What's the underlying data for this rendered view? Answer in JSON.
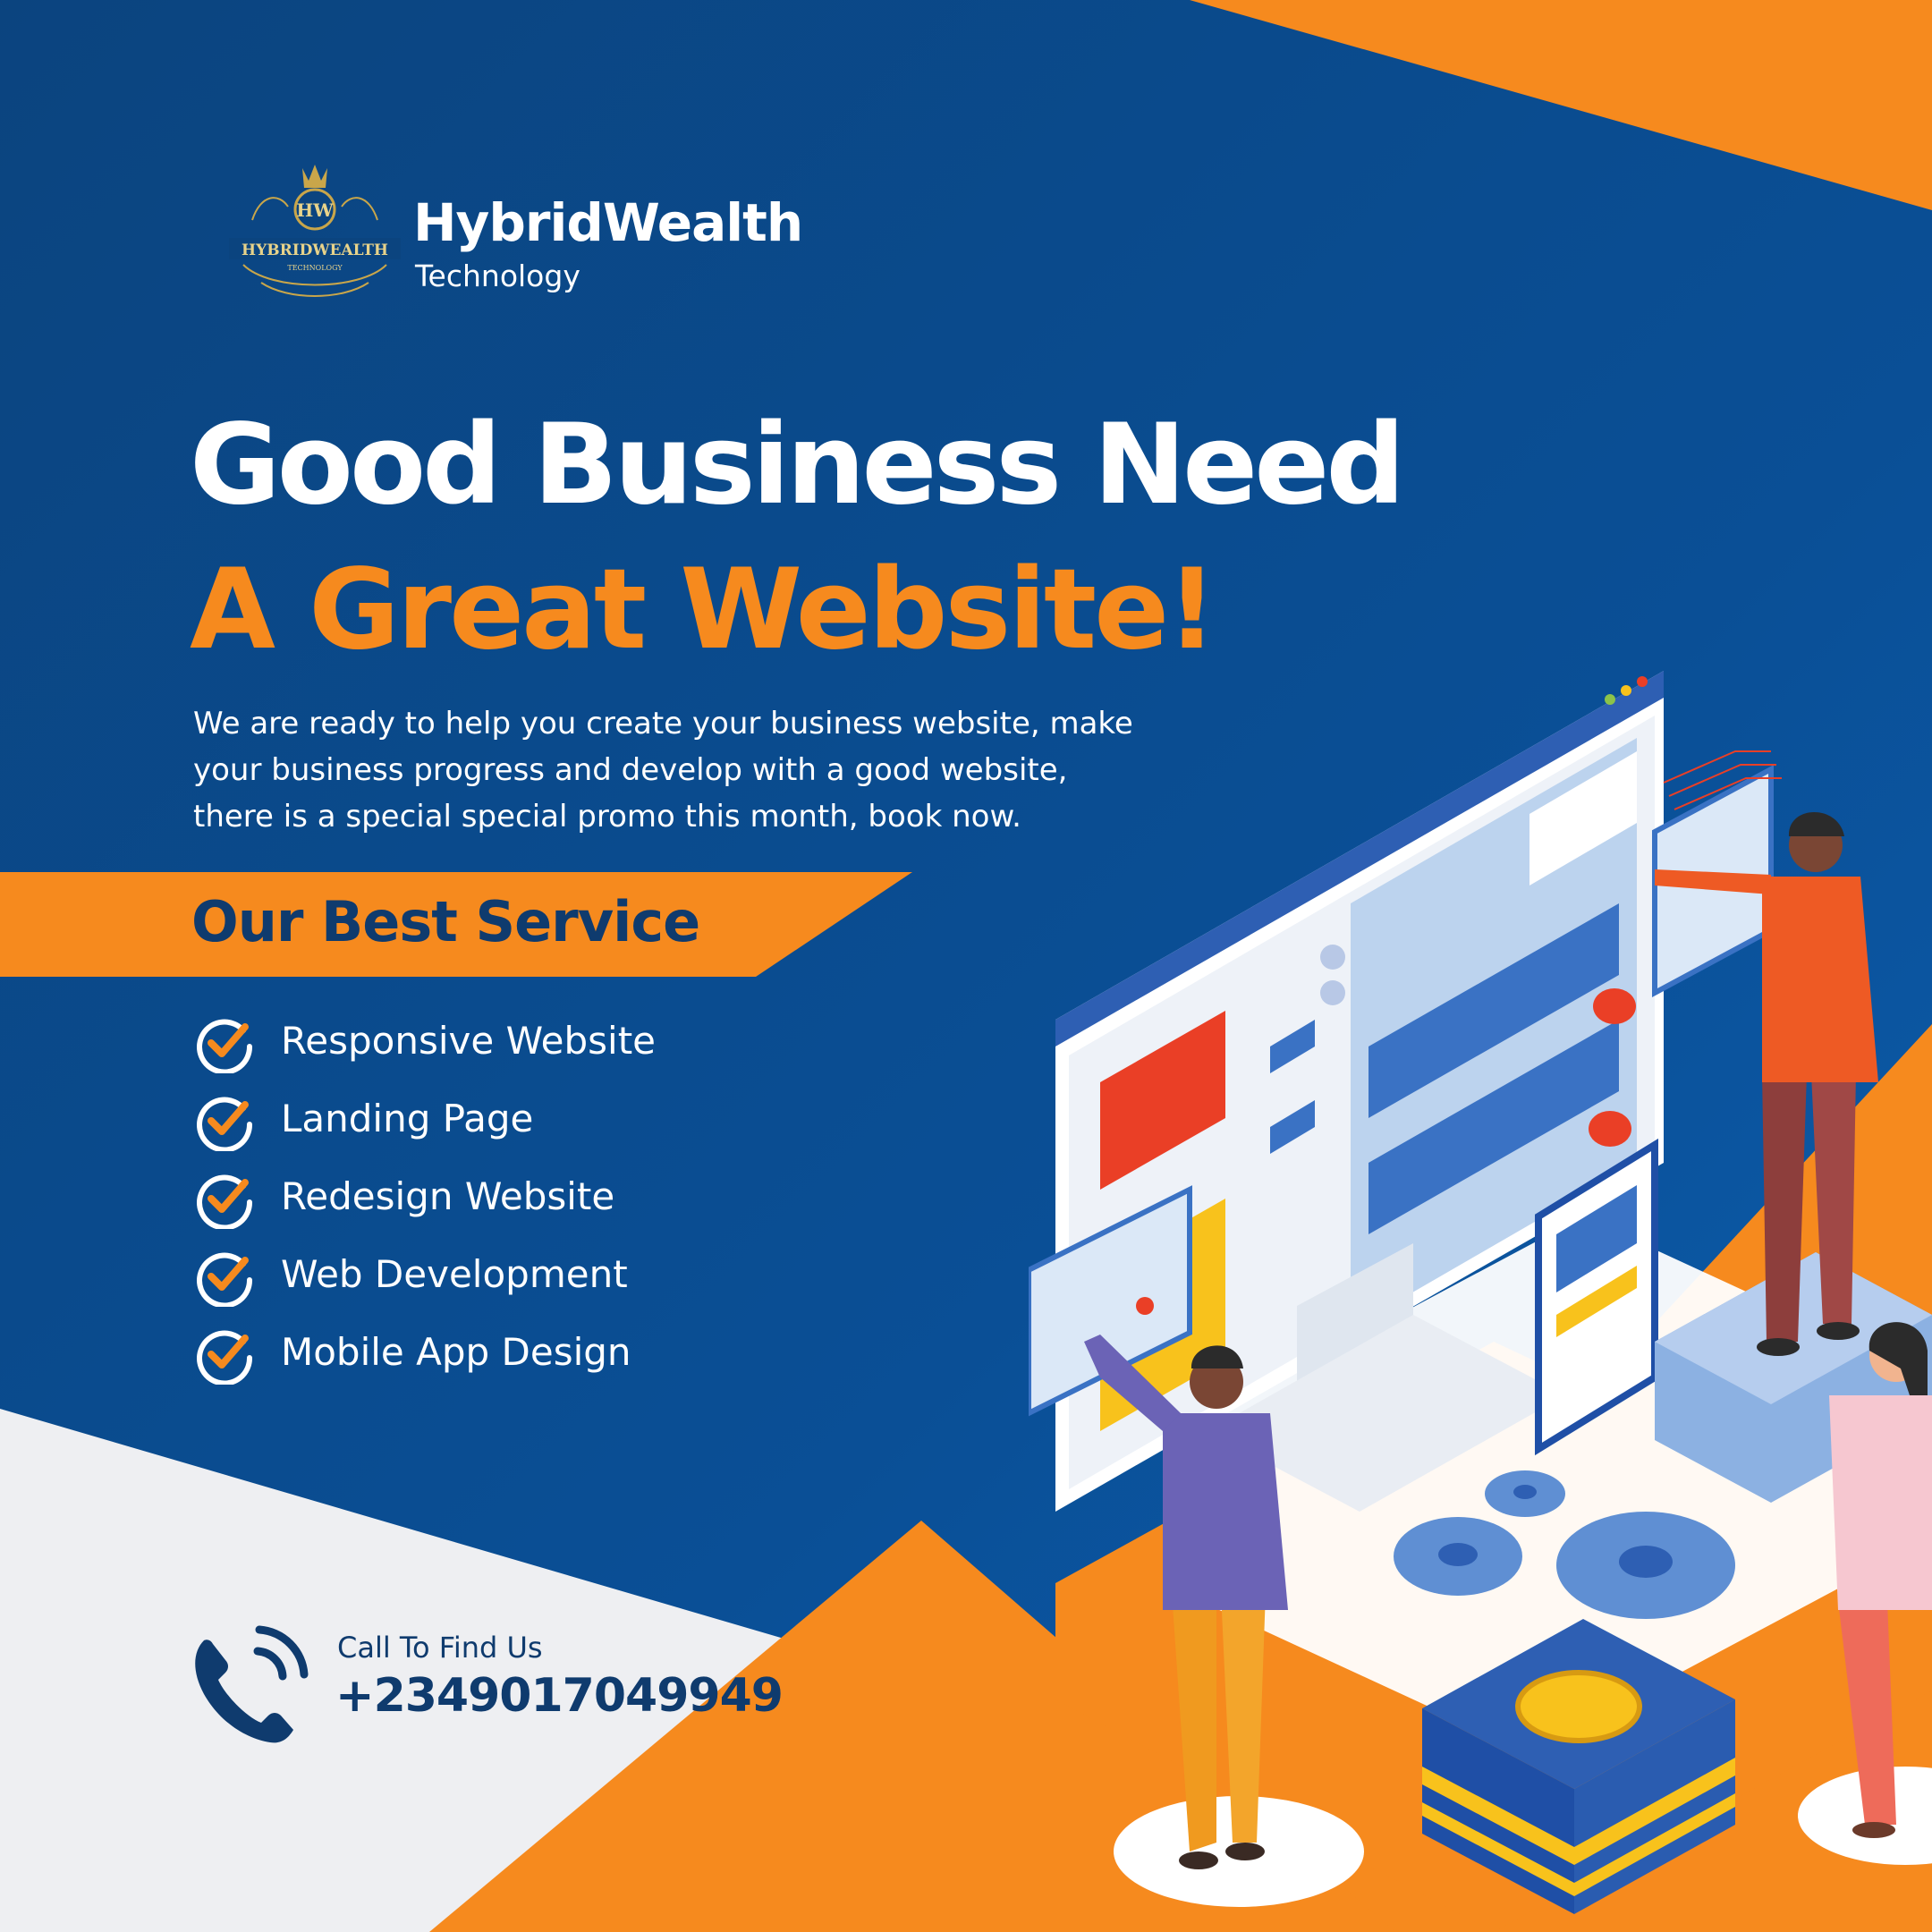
{
  "brand": {
    "name": "HybridWealth",
    "subtitle": "Technology",
    "logo_text": "HYBRIDWEALTH",
    "logo_sub": "TECHNOLOGY",
    "logo_monogram": "HW"
  },
  "headline": {
    "line1": "Good Business Need",
    "line2": "A Great Website!"
  },
  "intro_lines": [
    "We are ready to help you create your business website, make",
    "your business progress and develop with a good website,",
    "there is a special special promo this month, book now."
  ],
  "services": {
    "heading": "Our Best Service",
    "items": [
      "Responsive Website",
      "Landing Page",
      "Redesign Website",
      "Web Development",
      "Mobile App Design"
    ]
  },
  "contact": {
    "label": "Call To Find Us",
    "phone": "+2349017049949"
  },
  "colors": {
    "navy": "#0a4e95",
    "orange": "#f68a1e",
    "dark_text": "#0f3b6e",
    "light_gray": "#eeeff2"
  },
  "icons": [
    "check-circle-icon",
    "phone-icon",
    "gear-icon",
    "coin-icon"
  ]
}
